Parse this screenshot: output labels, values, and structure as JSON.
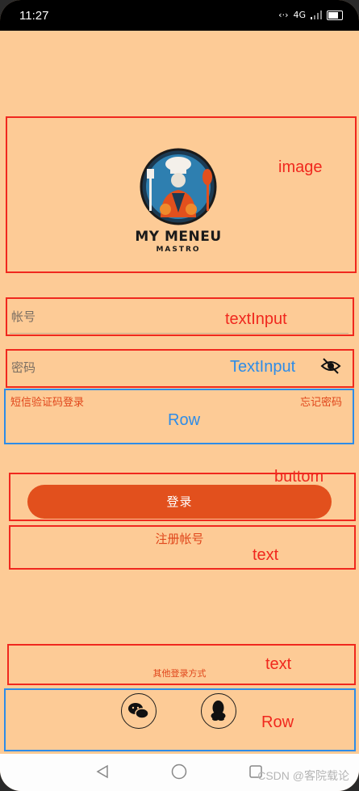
{
  "status_bar": {
    "time": "11:27",
    "network": "4G"
  },
  "logo": {
    "title": "MY MENEU",
    "subtitle": "MASTRO"
  },
  "account": {
    "placeholder": "帐号"
  },
  "password": {
    "placeholder": "密码"
  },
  "links": {
    "sms_login": "短信验证码登录",
    "forgot_password": "忘记密码"
  },
  "login": {
    "label": "登录"
  },
  "register": {
    "label": "注册帐号"
  },
  "other_login": {
    "label": "其他登录方式"
  },
  "social": {
    "wechat_icon": "wechat-icon",
    "qq_icon": "qq-icon"
  },
  "annotations": {
    "image": "image",
    "text_input_1": "textInput",
    "text_input_2": "TextInput",
    "row_1": "Row",
    "button": "buttom",
    "text_1": "text",
    "text_2": "text",
    "row_2": "Row"
  },
  "watermark": "CSDN @客院载论",
  "colors": {
    "background": "#fdcb96",
    "accent": "#e2501d",
    "annotation_red": "#f0281e",
    "annotation_blue": "#2d8ce8"
  }
}
